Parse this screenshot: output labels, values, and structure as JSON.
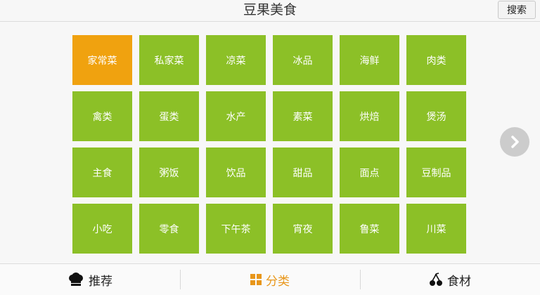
{
  "header": {
    "title": "豆果美食",
    "search_label": "搜索"
  },
  "categories": [
    "家常菜",
    "私家菜",
    "凉菜",
    "冰品",
    "海鲜",
    "肉类",
    "禽类",
    "蛋类",
    "水产",
    "素菜",
    "烘焙",
    "煲汤",
    "主食",
    "粥饭",
    "饮品",
    "甜品",
    "面点",
    "豆制品",
    "小吃",
    "零食",
    "下午茶",
    "宵夜",
    "鲁菜",
    "川菜"
  ],
  "active_category": "家常菜",
  "colors": {
    "tile": "#8cc027",
    "tile_active": "#f0a20f",
    "tab_active": "#e8961a"
  },
  "tabs": [
    {
      "label": "推荐",
      "icon": "chef-hat-icon"
    },
    {
      "label": "分类",
      "icon": "grid-icon",
      "active": true
    },
    {
      "label": "食材",
      "icon": "cherries-icon"
    }
  ]
}
